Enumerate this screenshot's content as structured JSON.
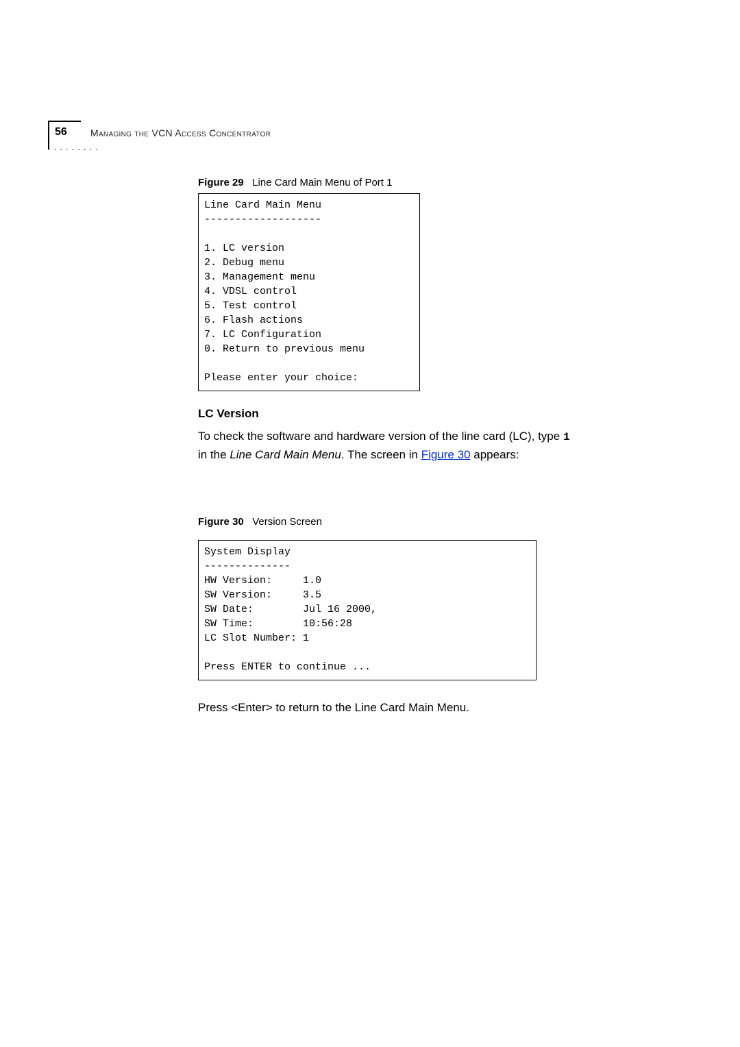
{
  "header": {
    "page_number": "56",
    "title": "Managing the VCN Access Concentrator",
    "dots": ". . . . . . . . ."
  },
  "figure29": {
    "label": "Figure 29",
    "caption": "Line Card Main Menu of Port 1",
    "menu_title": "Line Card Main Menu",
    "separator": "-------------------",
    "items": [
      "1. LC version",
      "2. Debug menu",
      "3. Management menu",
      "4. VDSL control",
      "5. Test control",
      "6. Flash actions",
      "7. LC Configuration",
      "0. Return to previous menu"
    ],
    "prompt": "Please enter your choice:"
  },
  "section": {
    "heading": "LC Version",
    "para_part1": "To check the software and hardware version of the line card (LC), type ",
    "para_mono": "1",
    "para_part2a": "in the ",
    "para_italic": "Line Card Main Menu",
    "para_part2b": ". The screen in ",
    "para_link": "Figure 30",
    "para_part3": " appears:"
  },
  "figure30": {
    "label": "Figure 30",
    "caption": "Version Screen",
    "lines": [
      "System Display",
      "--------------",
      "HW Version:     1.0",
      "SW Version:     3.5",
      "SW Date:        Jul 16 2000,",
      "SW Time:        10:56:28",
      "LC Slot Number: 1",
      "",
      "Press ENTER to continue ..."
    ]
  },
  "closing": "Press <Enter> to return to the Line Card Main Menu."
}
